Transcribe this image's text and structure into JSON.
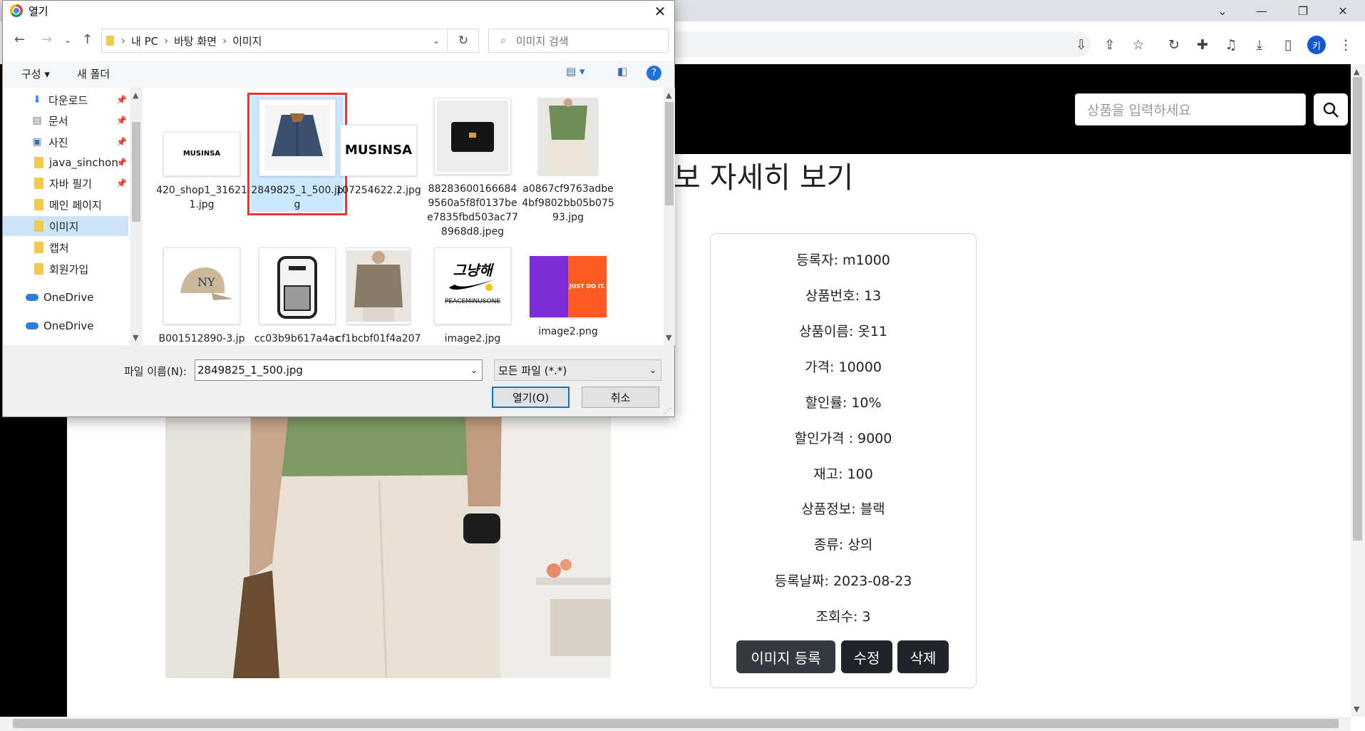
{
  "browser": {
    "window_controls": [
      "⌄",
      "—",
      "❐",
      "✕"
    ],
    "profile_initial": "키"
  },
  "page": {
    "search_placeholder": "상품을 입력하세요",
    "title_fragment": "보 자세히 보기",
    "card": {
      "rows": [
        "등록자: m1000",
        "상품번호: 13",
        "상품이름: 옷11",
        "가격: 10000",
        "할인률: 10%",
        "할인가격 : 9000",
        "재고: 100",
        "상품정보: 블랙",
        "종류: 상의",
        "등록날짜: 2023-08-23",
        "조회수: 3"
      ],
      "buttons": [
        "이미지 등록",
        "수정",
        "삭제"
      ]
    }
  },
  "dialog": {
    "title": "열기",
    "breadcrumb": [
      "내 PC",
      "바탕 화면",
      "이미지"
    ],
    "search_placeholder": "이미지 검색",
    "toolbar": {
      "organize": "구성 ▾",
      "new_folder": "새 폴더"
    },
    "nav_items": [
      {
        "label": "다운로드",
        "icon": "download-icon",
        "pinned": true
      },
      {
        "label": "문서",
        "icon": "document-icon",
        "pinned": true
      },
      {
        "label": "사진",
        "icon": "picture-icon",
        "pinned": true
      },
      {
        "label": "java_sinchon",
        "icon": "folder-icon",
        "pinned": true
      },
      {
        "label": "자바 필기",
        "icon": "folder-icon",
        "pinned": true
      },
      {
        "label": "메인 페이지",
        "icon": "folder-icon",
        "pinned": false
      },
      {
        "label": "이미지",
        "icon": "folder-icon",
        "pinned": false,
        "selected": true
      },
      {
        "label": "캡처",
        "icon": "folder-icon",
        "pinned": false
      },
      {
        "label": "회원가입",
        "icon": "folder-icon",
        "pinned": false
      },
      {
        "label": "OneDrive",
        "icon": "cloud-icon",
        "pinned": false
      },
      {
        "label": "OneDrive",
        "icon": "cloud-icon",
        "pinned": false
      }
    ],
    "files": [
      {
        "name": "420_shop1_316211.jpg",
        "thumb": "MUSINSA"
      },
      {
        "name": "2849825_1_500.jpg",
        "thumb": "jacket",
        "selected": true
      },
      {
        "name": "107254622.2.jpg",
        "thumb": "MUSINSA"
      },
      {
        "name": "882836001666849560a5f8f0137bee7835fbd503ac778968d8.jpeg",
        "thumb": "bag"
      },
      {
        "name": "a0867cf9763adbe4bf9802bb05b07593.jpg",
        "thumb": "person-green"
      },
      {
        "name": "B001512890-3.jp",
        "thumb": "cap"
      },
      {
        "name": "cc03b9b617a4ac",
        "thumb": "backpack"
      },
      {
        "name": "cf1bcbf01f4a207",
        "thumb": "person-brown"
      },
      {
        "name": "image2.jpg",
        "thumb": "그냥해",
        "caption": "PEACEMINUSONE"
      },
      {
        "name": "image2.png",
        "thumb": "JUST DO IT."
      }
    ],
    "filename_label": "파일 이름(N):",
    "filename_value": "2849825_1_500.jpg",
    "filetype_value": "모든 파일 (*.*)",
    "open_button": "열기(O)",
    "cancel_button": "취소"
  }
}
